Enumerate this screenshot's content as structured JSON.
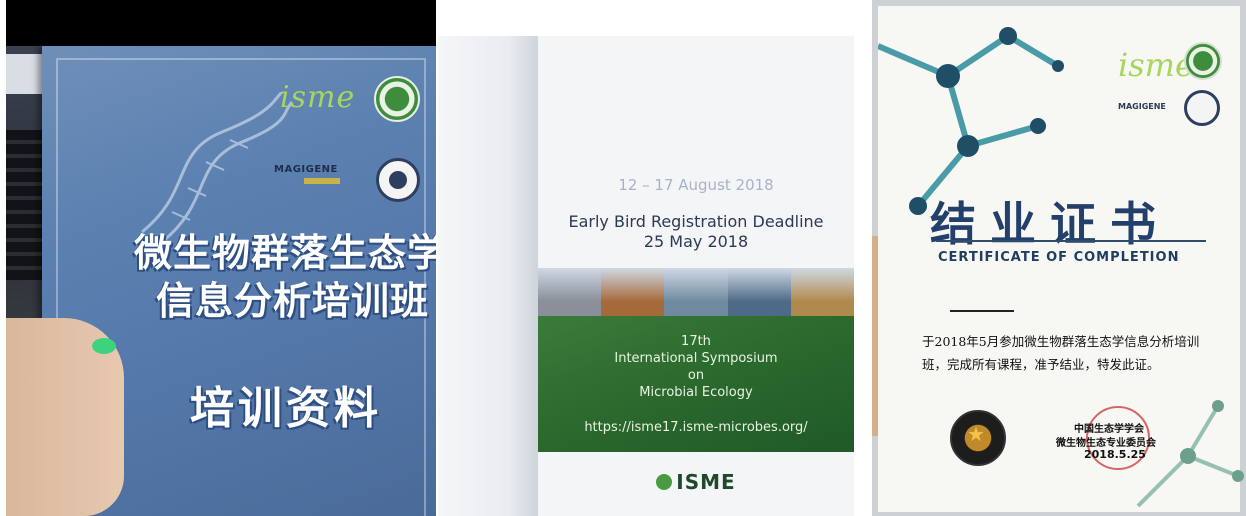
{
  "booklet": {
    "logo_text": "isme",
    "sponsor_logo": "MAGIGENE",
    "title_line1": "微生物群落生态学",
    "title_line2": "信息分析培训班",
    "subtitle": "培训资料"
  },
  "symposium": {
    "date_range": "12 – 17 August 2018",
    "early_bird_line1": "Early Bird Registration Deadline",
    "early_bird_line2": "25 May 2018",
    "edition": "17th",
    "name_line1": "International Symposium",
    "name_line2": "on",
    "name_line3": "Microbial Ecology",
    "url": "https://isme17.isme-microbes.org/",
    "footer_logo": "ISME",
    "photo_colors": [
      "#8a8f99",
      "#a56a3a",
      "#6f8aa0",
      "#4d6a86",
      "#b08a4c"
    ]
  },
  "certificate": {
    "logo_text": "isme",
    "sponsor_logo": "MAGIGENE",
    "title": "结业证书",
    "subtitle": "CERTIFICATE OF COMPLETION",
    "body": "于2018年5月参加微生物群落生态学信息分析培训班，完成所有课程，准予结业，特发此证。",
    "issuer_line1": "中国生态学学会",
    "issuer_line2": "微生物生态专业委员会",
    "date": "2018.5.25"
  },
  "colors": {
    "booklet_blue": "#5a80b0",
    "isme_green": "#a7d65b",
    "symposium_green": "#2c6a2e",
    "certificate_navy": "#233f6b",
    "molecule_teal": "#2a8c9a"
  }
}
